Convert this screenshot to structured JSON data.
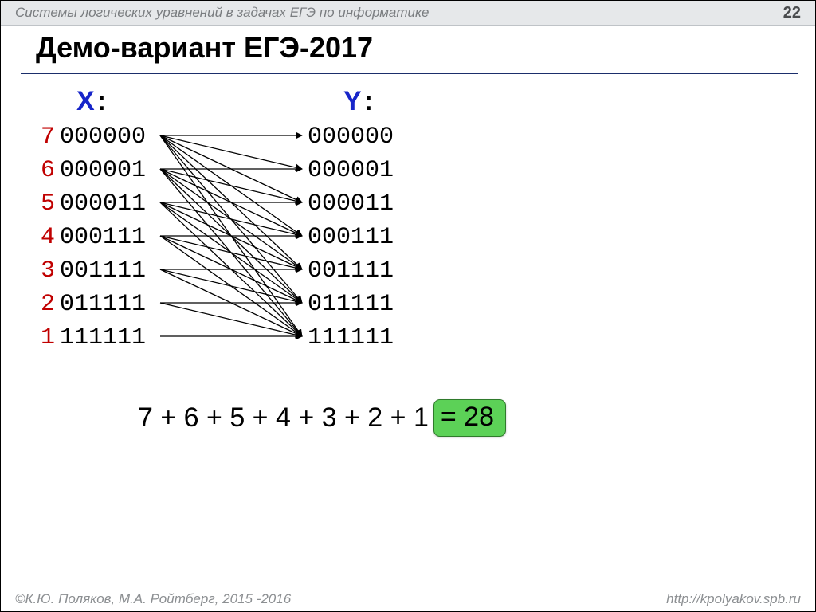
{
  "header": {
    "subject": "Системы логических уравнений в задачах ЕГЭ по информатике",
    "page": "22"
  },
  "title": "Демо-вариант ЕГЭ-2017",
  "labels": {
    "x": "X",
    "y": "Y",
    "colon": ":"
  },
  "x_rows": [
    {
      "idx": "7",
      "bits": "000000"
    },
    {
      "idx": "6",
      "bits": "000001"
    },
    {
      "idx": "5",
      "bits": "000011"
    },
    {
      "idx": "4",
      "bits": "000111"
    },
    {
      "idx": "3",
      "bits": "001111"
    },
    {
      "idx": "2",
      "bits": "011111"
    },
    {
      "idx": "1",
      "bits": "111111"
    }
  ],
  "y_rows": [
    "000000",
    "000001",
    "000011",
    "000111",
    "001111",
    "011111",
    "111111"
  ],
  "sum": {
    "expr": "7 + 6 + 5 + 4 + 3 + 2 + 1 ",
    "eq": "= 28"
  },
  "footer": {
    "left": "©К.Ю. Поляков, М.А. Ройтберг, 2015 -2016",
    "right": "http://kpolyakov.spb.ru"
  },
  "chart_data": {
    "type": "table",
    "description": "Mapping from X bit-patterns (count idx) to Y bit-patterns; each X row i (with idx count) maps to Y rows i..7",
    "edges": [
      [
        0,
        0
      ],
      [
        0,
        1
      ],
      [
        0,
        2
      ],
      [
        0,
        3
      ],
      [
        0,
        4
      ],
      [
        0,
        5
      ],
      [
        0,
        6
      ],
      [
        1,
        1
      ],
      [
        1,
        2
      ],
      [
        1,
        3
      ],
      [
        1,
        4
      ],
      [
        1,
        5
      ],
      [
        1,
        6
      ],
      [
        2,
        2
      ],
      [
        2,
        3
      ],
      [
        2,
        4
      ],
      [
        2,
        5
      ],
      [
        2,
        6
      ],
      [
        3,
        3
      ],
      [
        3,
        4
      ],
      [
        3,
        5
      ],
      [
        3,
        6
      ],
      [
        4,
        4
      ],
      [
        4,
        5
      ],
      [
        4,
        6
      ],
      [
        5,
        5
      ],
      [
        5,
        6
      ],
      [
        6,
        6
      ]
    ],
    "row_count": 7,
    "total": 28
  }
}
